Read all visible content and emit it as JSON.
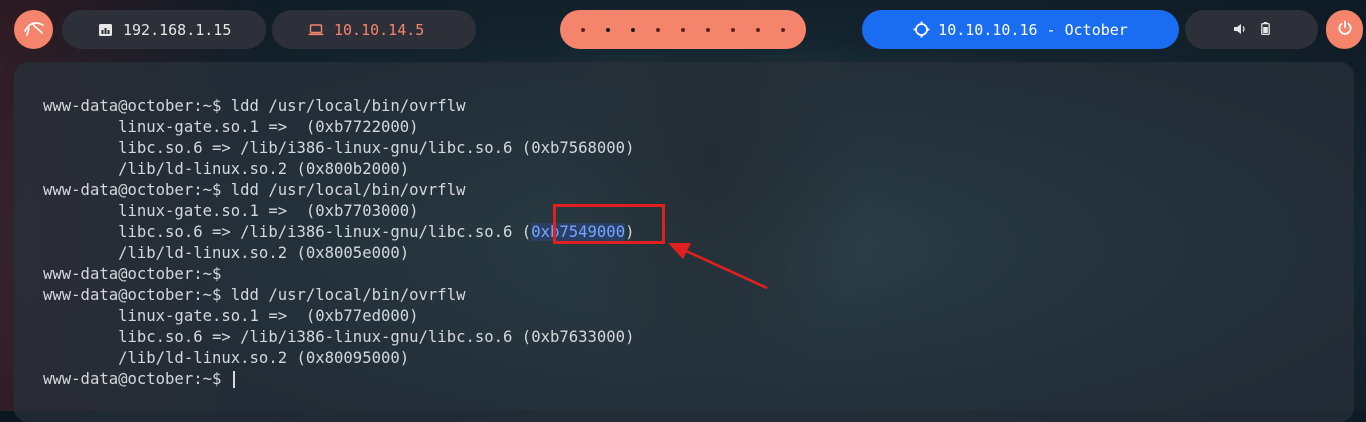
{
  "topbar": {
    "local_ip": "192.168.1.15",
    "vpn_ip": "10.10.14.5",
    "workspace_dots": [
      false,
      true,
      true,
      false,
      false,
      false,
      false,
      false,
      false
    ],
    "target": "10.10.10.16 - October"
  },
  "colors": {
    "accent": "#f4846b",
    "target_bg": "#1a6cf0",
    "pill_bg": "#2d3038",
    "highlight_border": "#e02020"
  },
  "terminal": {
    "lines": [
      "www-data@october:~$ ldd /usr/local/bin/ovrflw",
      "        linux-gate.so.1 =>  (0xb7722000)",
      "        libc.so.6 => /lib/i386-linux-gnu/libc.so.6 (0xb7568000)",
      "        /lib/ld-linux.so.2 (0x800b2000)",
      "www-data@october:~$ ldd /usr/local/bin/ovrflw",
      "        linux-gate.so.1 =>  (0xb7703000)",
      "        /lib/ld-linux.so.2 (0x8005e000)",
      "www-data@october:~$",
      "www-data@october:~$ ldd /usr/local/bin/ovrflw",
      "        linux-gate.so.1 =>  (0xb77ed000)",
      "        libc.so.6 => /lib/i386-linux-gnu/libc.so.6 (0xb7633000)",
      "        /lib/ld-linux.so.2 (0x80095000)",
      "www-data@october:~$ "
    ],
    "highlight_line_prefix": "        libc.so.6 => /lib/i386-linux-gnu/libc.so.6 (",
    "highlight_value": "0xb7549000",
    "highlight_line_suffix": ")"
  }
}
